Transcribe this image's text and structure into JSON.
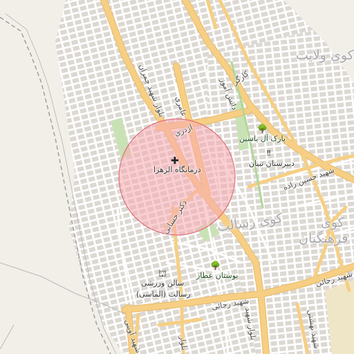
{
  "map": {
    "districts": {
      "velayat": "کوی ولایت",
      "resalat": "کوی رسالت",
      "farhangian_1": "کوی",
      "farhangian_2": "فرهنگیان"
    },
    "roads": {
      "shahid_chamran": "بلوار شهید چمران",
      "ameri": "عامری",
      "azhdari": "اژدری",
      "dr_hasani": "دکتر حسانی",
      "kargar": "کارگر",
      "danesh_amooz": "دانش آموز",
      "shahid_hossein_zadeh": "شهید حسین زاده",
      "shahid_rajaei_1": "شهید رجائی",
      "shahid_rajaei_2": "شهید رجائی",
      "bolvar_shahid_1": "بلوار شهید",
      "bolvar_shahid_2": "شهید بهشتی",
      "shahid_avini": "شهید آوینی",
      "bolvar_bottom": "بلوار"
    },
    "pois": {
      "clinic": "درمانگاه الزهرا",
      "park_al_yasin": "پارک آل یاسین",
      "tebyan_school": "دبیرستان تبیان",
      "attar_garden": "بوستان عطار",
      "sports_hall_1": "سالن ورزشی",
      "sports_hall_2": "رسالت (الماسی)"
    },
    "icons": {
      "clinic": "cross-icon",
      "park": "tree-icon",
      "school": "school-icon",
      "sports": "sports-hall-icon"
    },
    "colors": {
      "land": "#f2efe9",
      "building": "#dcd8d2",
      "major_road": "#f6cf84",
      "minor_road": "#ffffff",
      "park": "#c9e2b5",
      "rail": "#9a9a9a",
      "highlight_fill": "#f7a9b1",
      "highlight_stroke": "#e0707c"
    }
  }
}
